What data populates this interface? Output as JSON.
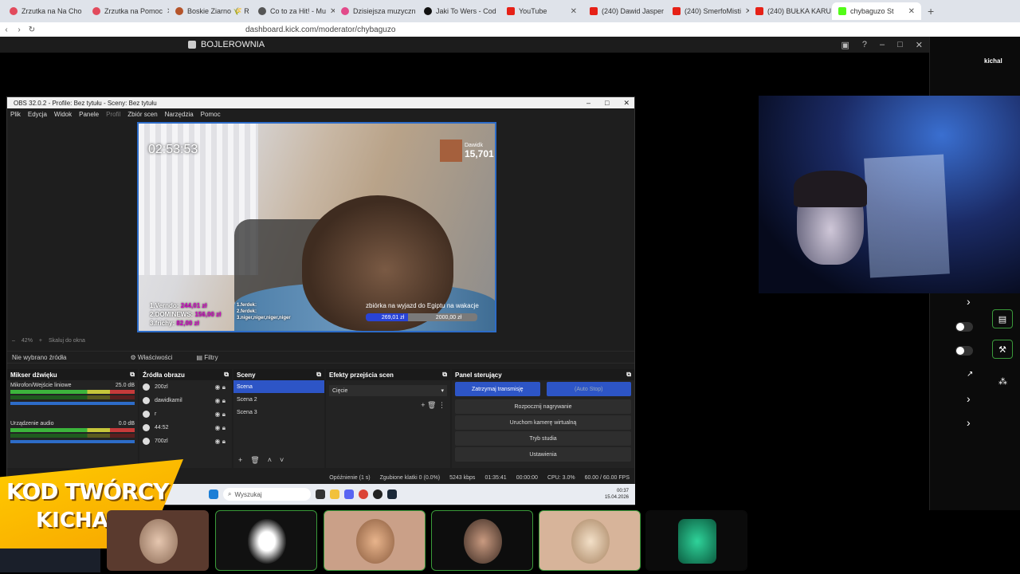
{
  "browser": {
    "tabs": [
      {
        "title": "Zrzutka na Na Cho",
        "color": "#e24a5c"
      },
      {
        "title": "Zrzutka na Pomoc",
        "color": "#e24a5c"
      },
      {
        "title": "Boskie Ziarno 🌾 R",
        "color": "#b5542a"
      },
      {
        "title": "Co to za Hit! - Mu",
        "color": "#555555"
      },
      {
        "title": "Dzisiejsza muzyczn",
        "color": "#e24a8a"
      },
      {
        "title": "Jaki To Wers - Cod",
        "color": "#111111"
      },
      {
        "title": "YouTube",
        "color": "#e62117"
      },
      {
        "title": "(240) Dawid Jasper",
        "color": "#e62117"
      },
      {
        "title": "(240) SmerfoMisti",
        "color": "#e62117"
      },
      {
        "title": "(240) BUŁKA KARU",
        "color": "#e62117"
      },
      {
        "title": "chybaguzo St",
        "color": "#53fc18",
        "active": true
      }
    ],
    "url": "dashboard.kick.com/moderator/chybaguzo"
  },
  "remote": {
    "title": "BOJLEROWNIA",
    "sidebar_label": "kichal"
  },
  "obs": {
    "title": "OBS 32.0.2 - Profile: Bez tytułu - Sceny: Bez tytułu",
    "menu": [
      "Plik",
      "Edycja",
      "Widok",
      "Panele",
      "Profil",
      "Zbiór scen",
      "Narzędzia",
      "Pomoc"
    ],
    "preview": {
      "timer": "02:53:53",
      "donor_name": "Dawidk",
      "donor_amount": "15,701",
      "leaderboard": [
        {
          "name": "1.Verndo:",
          "amount": "244,01 zł"
        },
        {
          "name": "2.DOMINEWS:",
          "amount": "156,00 zł"
        },
        {
          "name": "3.frichy:",
          "amount": "82,00 zł"
        }
      ],
      "leaderboard2": [
        "1.ferdek:",
        "2.ferdek:",
        "3.niger,niger,niger,niger"
      ],
      "goal_text": "zbiórka na wyjazd do Egiptu na wakacje",
      "goal_current": "269,01 zł",
      "goal_target": "2000,00 zł"
    },
    "zoom": "42%",
    "zoom_label": "Skaluj do okna",
    "no_source": "Nie wybrano źródła",
    "properties": "Właściwości",
    "filters": "Filtry",
    "docks": {
      "mixer": "Mikser dźwięku",
      "sources": "Źródła obrazu",
      "scenes": "Sceny",
      "transitions": "Efekty przejścia scen",
      "controls": "Panel sterujący"
    },
    "mixer": [
      {
        "name": "Mikrofon/Wejście liniowe",
        "db": "25.0 dB"
      },
      {
        "name": "Urządzenie audio",
        "db": "0.0 dB"
      }
    ],
    "sources": [
      "200zl",
      "dawidkamil",
      "r",
      "44:52",
      "700zl"
    ],
    "scenes": [
      "Scena",
      "Scena 2",
      "Scena 3"
    ],
    "transition": "Cięcie",
    "controls": {
      "stop_stream": "Zatrzymaj transmisję",
      "auto_stop": "(Auto Stop)",
      "record": "Rozpocznij nagrywanie",
      "virtual_cam": "Uruchom kamerę wirtualną",
      "studio": "Tryb studia",
      "settings": "Ustawienia"
    },
    "status": {
      "delay": "Opóźnienie (1 s)",
      "dropped": "Zgubione klatki 0 (0.0%)",
      "bitrate": "5243 kbps",
      "live_time": "01:35:41",
      "rec_time": "00:00:00",
      "cpu": "CPU: 3.0%",
      "fps": "60.00 / 60.00 FPS"
    }
  },
  "taskbar": {
    "search": "Wyszukaj",
    "time": "00:37",
    "date": "15.04.2026"
  },
  "promo": {
    "line1": "KOD TWÓRCY",
    "line2": "KICHAL"
  }
}
